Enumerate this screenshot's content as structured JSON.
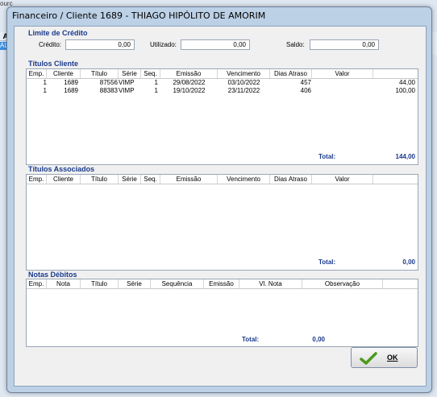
{
  "bg": {
    "top_text": "ourc",
    "left_a": "A",
    "left_b": "AL"
  },
  "window": {
    "title": "Financeiro / Cliente 1689 - THIAGO HIPÓLITO DE AMORIM"
  },
  "limite": {
    "title": "Limite de Crédito",
    "credito_label": "Crédito:",
    "credito": "0,00",
    "utilizado_label": "Utilizado:",
    "utilizado": "0,00",
    "saldo_label": "Saldo:",
    "saldo": "0,00"
  },
  "titulos_cliente": {
    "title": "Títulos Cliente",
    "headers": [
      "Emp.",
      "Cliente",
      "Título",
      "Série",
      "Seq.",
      "Emissão",
      "Vencimento",
      "Dias Atraso",
      "Valor"
    ],
    "rows": [
      [
        "1",
        "1689",
        "87556",
        "VIMP",
        "1",
        "29/08/2022",
        "03/10/2022",
        "457",
        "44,00"
      ],
      [
        "1",
        "1689",
        "88383",
        "VIMP",
        "1",
        "19/10/2022",
        "23/11/2022",
        "406",
        "100,00"
      ]
    ],
    "total_label": "Total:",
    "total": "144,00"
  },
  "titulos_associados": {
    "title": "Títulos Associados",
    "headers": [
      "Emp.",
      "Cliente",
      "Título",
      "Série",
      "Seq.",
      "Emissão",
      "Vencimento",
      "Dias Atraso",
      "Valor"
    ],
    "total_label": "Total:",
    "total": "0,00"
  },
  "notas_debitos": {
    "title": "Notas Débitos",
    "headers": [
      "Emp.",
      "Nota",
      "Título",
      "Série",
      "Sequência",
      "Emissão",
      "Vl. Nota",
      "Observação"
    ],
    "total_label": "Total:",
    "total": "0,00"
  },
  "ok_button": {
    "label": "OK"
  }
}
